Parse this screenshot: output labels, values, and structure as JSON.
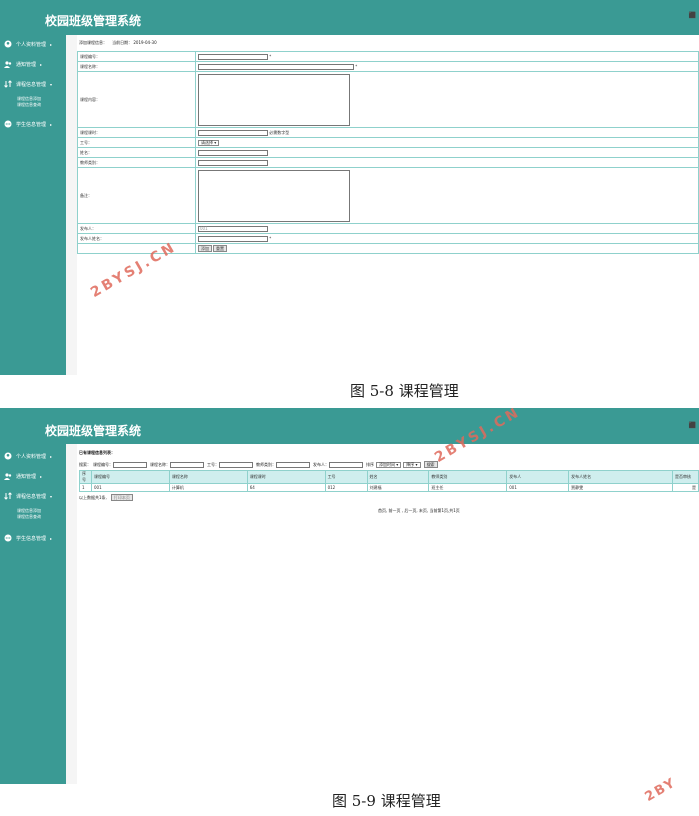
{
  "app": {
    "title": "校园班级管理系统"
  },
  "menu": [
    {
      "label": "个人资料管理",
      "icon": "user-circle-icon"
    },
    {
      "label": "通知管理",
      "icon": "users-icon"
    },
    {
      "label": "课程信息管理",
      "icon": "sort-icon"
    },
    {
      "label": "学生信息管理",
      "icon": "more-icon"
    }
  ],
  "submenu": {
    "add": "课程信息添加",
    "query": "课程信息查询"
  },
  "form": {
    "heading": "添加课程信息：",
    "date_label": "当前日期：",
    "date": "2019-04-30",
    "fields": {
      "code": "课程编号：",
      "name": "课程名称：",
      "content": "课程内容：",
      "hours": "课程课时：",
      "hours_hint": "必需数字型",
      "worker_id": "工号：",
      "worker_select": "请选择",
      "teacher_name": "姓名：",
      "teacher_type": "教师类别：",
      "remark": "备注：",
      "publisher": "发布人：",
      "publisher_value": "001",
      "publisher_name": "发布人姓名："
    },
    "required_mark": "*",
    "add_button": "添加",
    "reset_button": "重置"
  },
  "captions": {
    "fig8": "图 5-8 课程管理",
    "fig9": "图 5-9 课程管理"
  },
  "watermark": "2BYSJ.CN",
  "list": {
    "heading": "已有课程信息列表：",
    "search": {
      "label": "搜索：",
      "code": "课程编号：",
      "name": "课程名称：",
      "worker_id": "工号：",
      "teacher_type": "教师类别：",
      "publisher": "发布人：",
      "sort_label": "排序",
      "sort_field": "添加时间",
      "sort_order": "降序",
      "button": "搜索"
    },
    "columns": [
      "序号",
      "课程编号",
      "课程名称",
      "课程课时",
      "工号",
      "姓名",
      "教师类别",
      "发布人",
      "发布人姓名",
      "是否审核"
    ],
    "rows": [
      [
        "1",
        "001",
        "计算机",
        "64",
        "012",
        "刘建福",
        "班主任",
        "001",
        "贾静雯",
        "是"
      ]
    ],
    "total_label": "以上数据共1条,",
    "print_button": "打印本页",
    "pagination": "首页, 前一页 , 后一页, 末页, 当前第1页,共1页"
  }
}
